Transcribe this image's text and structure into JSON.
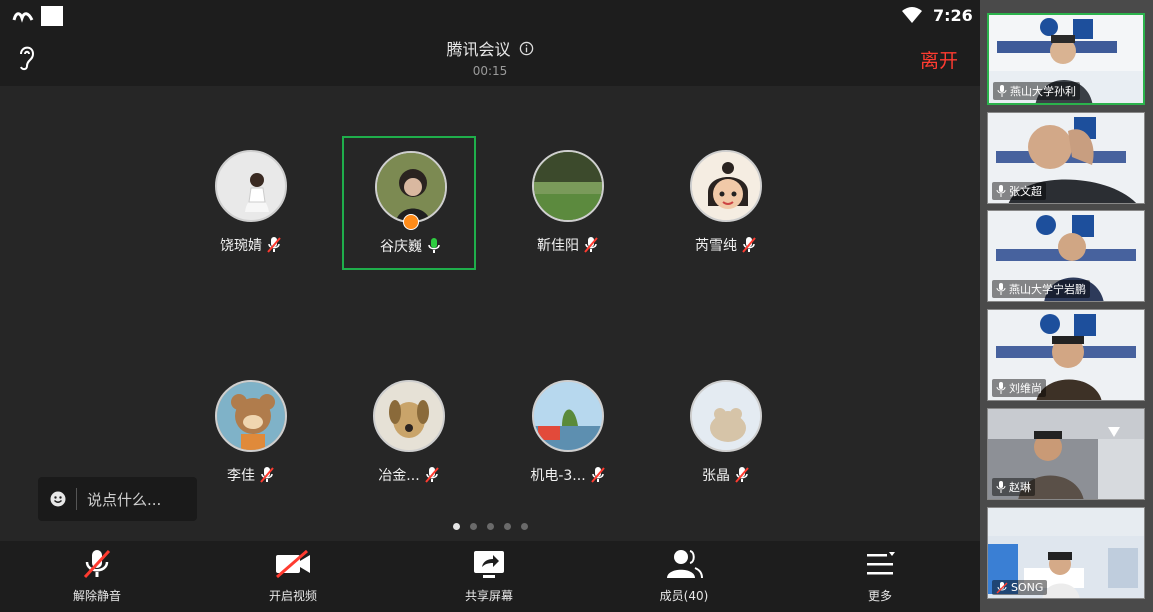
{
  "status_bar": {
    "time": "7:26"
  },
  "header": {
    "title": "腾讯会议",
    "timer": "00:15",
    "leave_label": "离开"
  },
  "participants": [
    {
      "name": "饶琬婧",
      "mic": "muted"
    },
    {
      "name": "谷庆巍",
      "mic": "speaking"
    },
    {
      "name": "靳佳阳",
      "mic": "muted"
    },
    {
      "name": "芮雪纯",
      "mic": "muted"
    },
    {
      "name": "李佳",
      "mic": "muted"
    },
    {
      "name": "冶金...",
      "mic": "muted"
    },
    {
      "name": "机电-3...",
      "mic": "muted"
    },
    {
      "name": "张晶",
      "mic": "muted"
    }
  ],
  "chat": {
    "placeholder": "说点什么..."
  },
  "pager": {
    "pages": 5,
    "current": 1
  },
  "toolbar": {
    "unmute_label": "解除静音",
    "video_label": "开启视频",
    "share_label": "共享屏幕",
    "members_label": "成员(40)",
    "more_label": "更多"
  },
  "video_tiles": [
    {
      "name": "燕山大学孙利",
      "mic": "on"
    },
    {
      "name": "张文超",
      "mic": "on"
    },
    {
      "name": "燕山大学宁岩鹏",
      "mic": "on"
    },
    {
      "name": "刘维尚",
      "mic": "on"
    },
    {
      "name": "赵琳",
      "mic": "on"
    },
    {
      "name": "SONG",
      "mic": "muted"
    }
  ],
  "colors": {
    "leave": "#ff3b30",
    "active_border": "#1fae4b",
    "muted_mic": "#ff3b30"
  }
}
